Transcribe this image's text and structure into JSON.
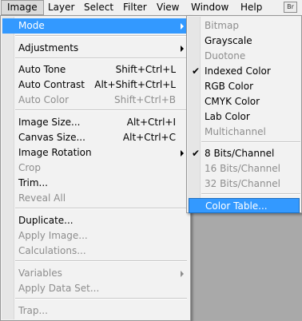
{
  "menubar": {
    "items": [
      "Image",
      "Layer",
      "Select",
      "Filter",
      "View",
      "Window",
      "Help"
    ],
    "br_label": "Br"
  },
  "image_menu": {
    "mode": "Mode",
    "adjustments": "Adjustments",
    "auto_tone": {
      "label": "Auto Tone",
      "shortcut": "Shift+Ctrl+L"
    },
    "auto_contrast": {
      "label": "Auto Contrast",
      "shortcut": "Alt+Shift+Ctrl+L"
    },
    "auto_color": {
      "label": "Auto Color",
      "shortcut": "Shift+Ctrl+B"
    },
    "image_size": {
      "label": "Image Size...",
      "shortcut": "Alt+Ctrl+I"
    },
    "canvas_size": {
      "label": "Canvas Size...",
      "shortcut": "Alt+Ctrl+C"
    },
    "image_rotation": "Image Rotation",
    "crop": "Crop",
    "trim": "Trim...",
    "reveal_all": "Reveal All",
    "duplicate": "Duplicate...",
    "apply_image": "Apply Image...",
    "calculations": "Calculations...",
    "variables": "Variables",
    "apply_data_set": "Apply Data Set...",
    "trap": "Trap..."
  },
  "mode_menu": {
    "bitmap": "Bitmap",
    "grayscale": "Grayscale",
    "duotone": "Duotone",
    "indexed_color": "Indexed Color",
    "rgb_color": "RGB Color",
    "cmyk_color": "CMYK Color",
    "lab_color": "Lab Color",
    "multichannel": "Multichannel",
    "bits8": "8 Bits/Channel",
    "bits16": "16 Bits/Channel",
    "bits32": "32 Bits/Channel",
    "color_table": "Color Table...",
    "check_glyph": "✔"
  }
}
